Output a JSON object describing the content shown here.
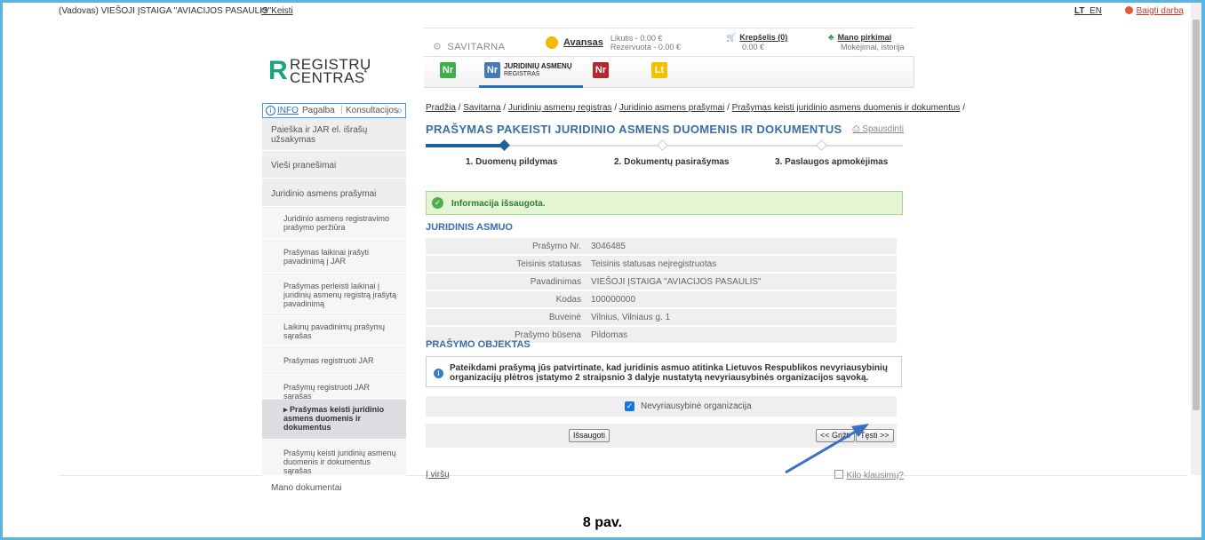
{
  "topbar": {
    "organization": "(Vadovas)  VIEŠOJI ĮSTAIGA \"AVIACIJOS PASAULIS\"",
    "change_label": "Keisti",
    "lang_lt": "LT",
    "lang_en": "EN",
    "end_work": "Baigti darbą"
  },
  "logo": {
    "line1": "REGISTRŲ",
    "line2": "CENTRAS"
  },
  "header": {
    "savitarna": "SAVITARNA",
    "avansas_label": "Avansas",
    "likutis": "Likutis - 0.00 €",
    "rezervuota": "Rezervuota - 0.00 €",
    "krepselis_label": "Krepšelis (0)",
    "krepselis_sum": "0.00 €",
    "pirkimai_label": "Mano pirkimai",
    "pirkimai_sub": "Mokėjimai, istorija",
    "tabs": [
      {
        "icon_text": "Nr",
        "color": "#3fae49"
      },
      {
        "icon_text": "Nr",
        "color": "#4a78b5",
        "label1": "JURIDINIŲ ASMENŲ",
        "label2": "REGISTRAS"
      },
      {
        "icon_text": "Nr",
        "color": "#b5262f"
      },
      {
        "icon_text": "Lt",
        "color": "#f2c200"
      }
    ]
  },
  "search": {
    "info": "INFO",
    "pagalba": "Pagalba",
    "konsultacijos": "Konsultacijos"
  },
  "menu": [
    {
      "label": "Paieška ir JAR el. išrašų užsakymas",
      "type": "main"
    },
    {
      "label": "Vieši pranešimai",
      "type": "main"
    },
    {
      "label": "Juridinio asmens prašymai",
      "type": "main"
    },
    {
      "label": "Juridinio asmens registravimo prašymo peržiūra",
      "type": "sub"
    },
    {
      "label": "Prašymas laikinai įrašyti pavadinimą į JAR",
      "type": "sub"
    },
    {
      "label": "Prašymas perleisti laikinai į juridinių asmenų registrą įrašytą pavadinimą",
      "type": "sub"
    },
    {
      "label": "Laikinų pavadinimų prašymų sąrašas",
      "type": "sub"
    },
    {
      "label": "Prašymas registruoti JAR",
      "type": "sub"
    },
    {
      "label": "Prašymų registruoti JAR sąrašas",
      "type": "sub"
    },
    {
      "label": "Prašymas keisti juridinio asmens duomenis ir dokumentus",
      "type": "selected"
    },
    {
      "label": "Prašymų keisti juridinių asmenų duomenis ir dokumentus sąrašas",
      "type": "sub"
    },
    {
      "label": "Mano dokumentai",
      "type": "main"
    }
  ],
  "breadcrumb": {
    "items": [
      "Pradžia",
      "Savitarna",
      "Juridinių asmenų registras",
      "Juridinio asmens prašymai",
      "Prašymas keisti juridinio asmens duomenis ir dokumentus"
    ],
    "sep": " / "
  },
  "page": {
    "title": "PRAŠYMAS PAKEISTI JURIDINIO ASMENS DUOMENIS IR DOKUMENTUS",
    "print": "Spausdinti",
    "steps": [
      "1. Duomenų pildymas",
      "2. Dokumentų pasirašymas",
      "3. Paslaugos apmokėjimas"
    ],
    "current_step": 1,
    "success": "Informacija išsaugota.",
    "section1": "JURIDINIS ASMUO",
    "rows": [
      {
        "k": "Prašymo Nr.",
        "v": "3046485"
      },
      {
        "k": "Teisinis statusas",
        "v": "Teisinis statusas neįregistruotas"
      },
      {
        "k": "Pavadinimas",
        "v": "VIEŠOJI ĮSTAIGA \"AVIACIJOS PASAULIS\""
      },
      {
        "k": "Kodas",
        "v": "100000000"
      },
      {
        "k": "Buveinė",
        "v": "Vilnius, Vilniaus g. 1"
      },
      {
        "k": "Prašymo būsena",
        "v": "Pildomas"
      }
    ],
    "section2": "PRAŠYMO OBJEKTAS",
    "note": "Pateikdami prašymą jūs patvirtinate, kad juridinis asmuo atitinka Lietuvos Respublikos nevyriausybinių organizacijų plėtros įstatymo 2 straipsnio 3 dalyje nustatytą nevyriausybinės organizacijos sąvoką.",
    "checkbox_label": "Nevyriausybinė organizacija",
    "checkbox_checked": true,
    "save_button": "Išsaugoti",
    "back_button": "<< Grįžti",
    "next_button": "Tęsti >>",
    "top_link": "Į viršų",
    "questions_link": "Kilo klausimų?"
  },
  "caption": "8 pav.",
  "colors": {
    "accent": "#3a6ea5",
    "progress": "#1f5fa0",
    "arrow": "#3b6fc4"
  }
}
